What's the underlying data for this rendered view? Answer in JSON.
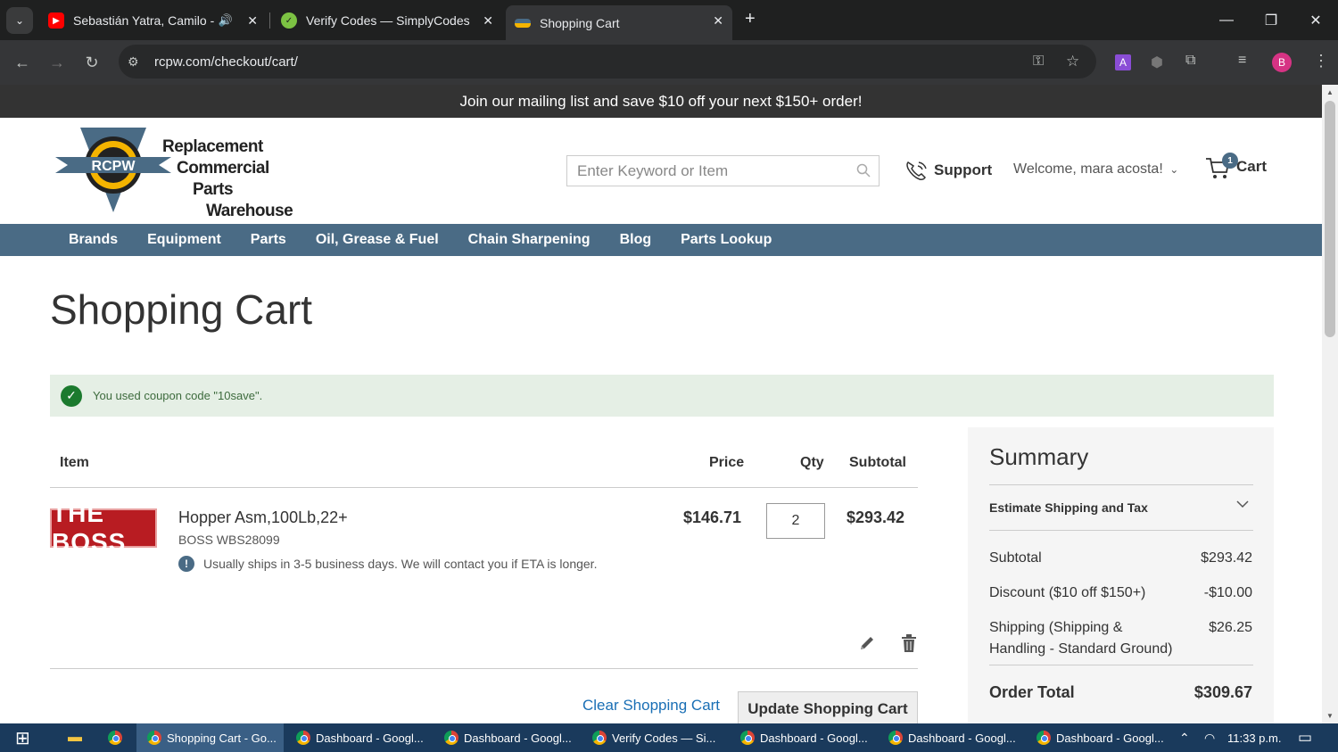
{
  "browser": {
    "tabs": [
      {
        "title": "Sebastián Yatra, Camilo - En",
        "icon": "youtube-icon"
      },
      {
        "title": "Verify Codes — SimplyCodes",
        "icon": "simplycodes-icon"
      },
      {
        "title": "Shopping Cart",
        "icon": "rcpw-favicon"
      }
    ],
    "url": "rcpw.com/checkout/cart/",
    "profile_initial": "B",
    "extension_initial": "A"
  },
  "promo": "Join our mailing list and save $10 off your next $150+ order!",
  "header": {
    "logo_badge": "RCPW",
    "logo_lines": [
      "Replacement",
      "Commercial",
      "Parts",
      "Warehouse"
    ],
    "search_placeholder": "Enter Keyword or Item",
    "support": "Support",
    "welcome": "Welcome, mara acosta!",
    "cart_label": "Cart",
    "cart_count": "1"
  },
  "nav": [
    "Brands",
    "Equipment",
    "Parts",
    "Oil, Grease & Fuel",
    "Chain Sharpening",
    "Blog",
    "Parts Lookup"
  ],
  "page_title": "Shopping Cart",
  "notice": "You used coupon code \"10save\".",
  "table": {
    "headers": {
      "item": "Item",
      "price": "Price",
      "qty": "Qty",
      "subtotal": "Subtotal"
    },
    "item": {
      "brand_logo": "THE BOSS",
      "name": "Hopper Asm,100Lb,22+",
      "sku": "BOSS WBS28099",
      "note": "Usually ships in 3-5 business days. We will contact you if ETA is longer.",
      "price": "$146.71",
      "qty": "2",
      "subtotal": "$293.42"
    },
    "clear": "Clear Shopping Cart",
    "update": "Update Shopping Cart"
  },
  "summary": {
    "title": "Summary",
    "estimate": "Estimate Shipping and Tax",
    "subtotal_label": "Subtotal",
    "subtotal": "$293.42",
    "discount_label": "Discount ($10 off $150+)",
    "discount": "-$10.00",
    "shipping_label_1": "Shipping (Shipping &",
    "shipping_label_2": "Handling - Standard Ground)",
    "shipping": "$26.25",
    "total_label": "Order Total",
    "total": "$309.67"
  },
  "taskbar": {
    "apps": [
      "Shopping Cart - Go...",
      "Dashboard - Googl...",
      "Dashboard - Googl...",
      "Verify Codes — Si...",
      "Dashboard - Googl...",
      "Dashboard - Googl...",
      "Dashboard - Googl..."
    ],
    "time": "11:33 p.m."
  }
}
